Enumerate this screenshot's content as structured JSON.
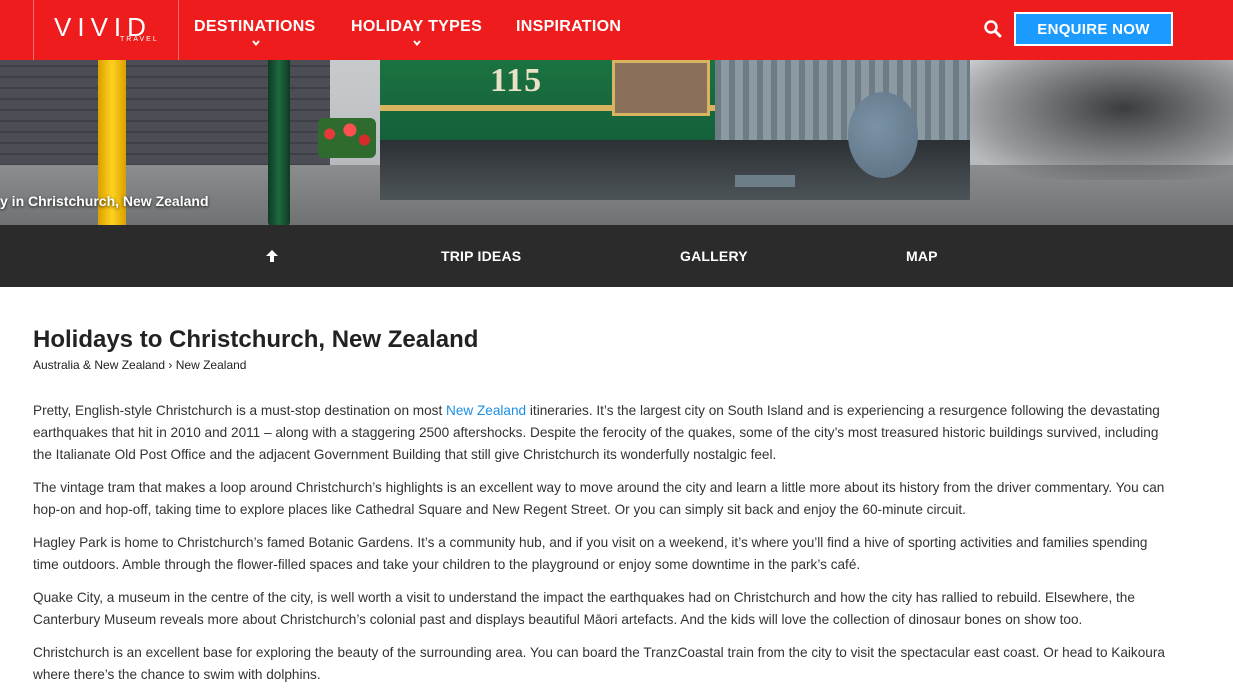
{
  "header": {
    "logo_text": "VIVID",
    "logo_subtext": "TRAVEL",
    "nav": [
      {
        "label": "DESTINATIONS",
        "has_dropdown": true
      },
      {
        "label": "HOLIDAY TYPES",
        "has_dropdown": true
      },
      {
        "label": "INSPIRATION",
        "has_dropdown": false
      }
    ],
    "search_icon": "search-icon",
    "cta_label": "ENQUIRE NOW"
  },
  "hero": {
    "tram_number": "115",
    "caption": "y in Christchurch, New Zealand"
  },
  "subnav": {
    "up_icon": "arrow-up-icon",
    "items": [
      "TRIP IDEAS",
      "GALLERY",
      "MAP"
    ]
  },
  "page": {
    "title": "Holidays to Christchurch, New Zealand",
    "breadcrumb": [
      "Australia & New Zealand",
      "New Zealand"
    ],
    "breadcrumb_separator": "›",
    "paragraph1": {
      "before_link": "Pretty, English-style Christchurch is a must-stop destination on most ",
      "link_text": "New Zealand",
      "after_link": " itineraries. It’s the largest city on South Island and is experiencing a resurgence following the devastating earthquakes that hit in 2010 and 2011 – along with a staggering 2500 aftershocks. Despite the ferocity of the quakes, some of the city’s most treasured historic buildings survived, including the Italianate Old Post Office and the adjacent Government Building that still give Christchurch its wonderfully nostalgic feel."
    },
    "paragraphs": [
      "The vintage tram that makes a loop around Christchurch’s highlights is an excellent way to move around the city and learn a little more about its history from the driver commentary. You can hop-on and hop-off, taking time to explore places like Cathedral Square and New Regent Street. Or you can simply sit back and enjoy the 60-minute circuit.",
      "Hagley Park is home to Christchurch’s famed Botanic Gardens. It’s a community hub, and if you visit on a weekend, it’s where you’ll find a hive of sporting activities and families spending time outdoors. Amble through the flower-filled spaces and take your children to the playground or enjoy some downtime in the park’s café.",
      "Quake City, a museum in the centre of the city, is well worth a visit to understand the impact the earthquakes had on Christchurch and how the city has rallied to rebuild. Elsewhere, the Canterbury Museum reveals more about Christchurch’s colonial past and displays beautiful Māori artefacts. And the kids will love the collection of dinosaur bones on show too.",
      "Christchurch is an excellent base for exploring the beauty of the surrounding area. You can board the TranzCoastal train from the city to visit the spectacular east coast. Or head to Kaikoura where there’s the chance to swim with dolphins."
    ]
  },
  "colors": {
    "brand_red": "#ee1c1c",
    "cta_blue": "#1b9bff",
    "subnav_bg": "#2b2b2b",
    "link_blue": "#1b8fe6"
  }
}
